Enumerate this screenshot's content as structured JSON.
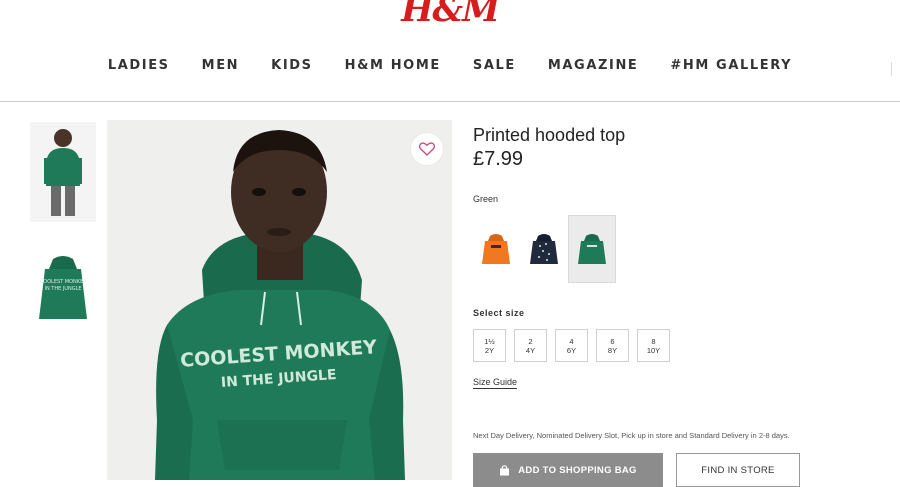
{
  "brand": {
    "logo_text": "H&M",
    "color": "#d81b1b"
  },
  "nav": {
    "items": [
      {
        "label": "LADIES"
      },
      {
        "label": "MEN"
      },
      {
        "label": "KIDS"
      },
      {
        "label": "H&M HOME"
      },
      {
        "label": "SALE"
      },
      {
        "label": "MAGAZINE"
      },
      {
        "label": "#HM GALLERY"
      }
    ]
  },
  "gallery": {
    "thumbnails": [
      {
        "icon": "model-photo"
      },
      {
        "icon": "hoodie-photo"
      }
    ],
    "favourite_icon": "heart-icon"
  },
  "product": {
    "title": "Printed hooded top",
    "price": "£7.99",
    "color_label": "Green",
    "colors": [
      {
        "name": "orange",
        "hex": "#f07820"
      },
      {
        "name": "dark-blue-print",
        "hex": "#1f2a3c"
      },
      {
        "name": "green",
        "hex": "#1e7a58",
        "selected": true
      }
    ],
    "size_label": "Select size",
    "sizes": [
      {
        "line1": "1½",
        "line2": "2Y"
      },
      {
        "line1": "2",
        "line2": "4Y"
      },
      {
        "line1": "4",
        "line2": "6Y"
      },
      {
        "line1": "6",
        "line2": "8Y"
      },
      {
        "line1": "8",
        "line2": "10Y"
      }
    ],
    "size_guide": "Size Guide",
    "delivery_text": "Next Day Delivery, Nominated Delivery Slot, Pick up in store and Standard Delivery in 2-8 days.",
    "add_to_bag": "ADD TO SHOPPING BAG",
    "find_in_store": "FIND IN STORE"
  },
  "colors": {
    "hoodie_green": "#1e7a58",
    "button_grey": "#8c8c8c"
  }
}
